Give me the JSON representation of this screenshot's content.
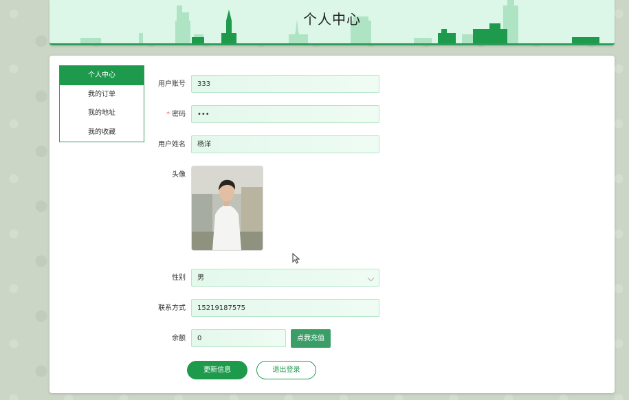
{
  "header": {
    "title": "个人中心"
  },
  "sidebar": {
    "items": [
      {
        "label": "个人中心",
        "active": true
      },
      {
        "label": "我的订单",
        "active": false
      },
      {
        "label": "我的地址",
        "active": false
      },
      {
        "label": "我的收藏",
        "active": false
      }
    ]
  },
  "form": {
    "account": {
      "label": "用户账号",
      "value": "333"
    },
    "password": {
      "label": "密码",
      "required_mark": "*",
      "value": "•••"
    },
    "name": {
      "label": "用户姓名",
      "value": "杨洋"
    },
    "avatar": {
      "label": "头像"
    },
    "gender": {
      "label": "性别",
      "value": "男"
    },
    "phone": {
      "label": "联系方式",
      "value": "15219187575"
    },
    "balance": {
      "label": "余额",
      "value": "0",
      "recharge_label": "点我充值"
    }
  },
  "actions": {
    "update_label": "更新信息",
    "logout_label": "退出登录"
  },
  "colors": {
    "primary": "#1e9a4c",
    "header_bg": "#dcf7e8",
    "input_bg": "#e4f8ec",
    "input_border": "#b6e6c9",
    "required": "#f56c6c"
  }
}
